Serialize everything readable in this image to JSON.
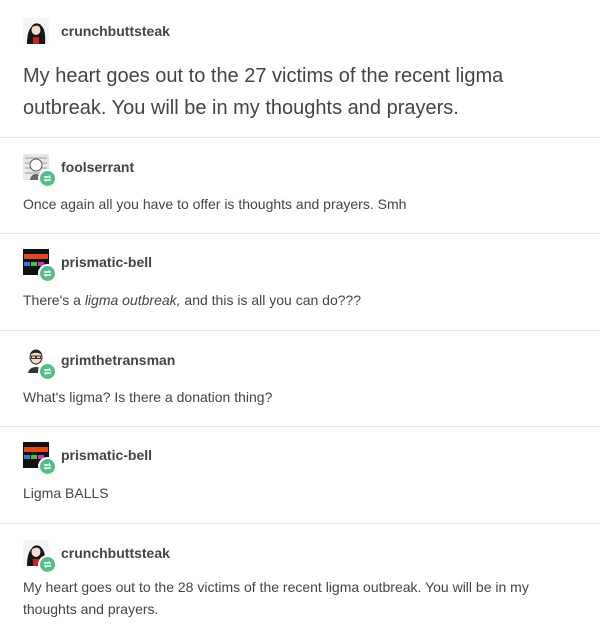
{
  "posts": [
    {
      "username": "crunchbuttsteak",
      "text": "My heart goes out to the 27 victims of the recent ligma outbreak. You will be in my thoughts and prayers.",
      "avatar_icon": "user-avatar-icon"
    },
    {
      "username": "foolserrant",
      "text": "Once again all you have to offer is thoughts and prayers. Smh",
      "avatar_icon": "user-avatar-icon"
    },
    {
      "username": "prismatic-bell",
      "text_before": "There's a ",
      "text_italic": "ligma outbreak,",
      "text_after": " and this is all you can do???",
      "avatar_icon": "queer-avatar-icon"
    },
    {
      "username": "grimthetransman",
      "text": "What's ligma? Is there a donation thing?",
      "avatar_icon": "user-avatar-icon"
    },
    {
      "username": "prismatic-bell",
      "text": "Ligma BALLS",
      "avatar_icon": "queer-avatar-icon"
    },
    {
      "username": "crunchbuttsteak",
      "text": "My heart goes out to the 28 victims of the recent ligma outbreak. You will be in my thoughts and prayers.",
      "avatar_icon": "user-avatar-icon"
    }
  ],
  "colors": {
    "reblog_badge": "#56bc8a",
    "text": "#444444",
    "divider": "#e4e4e4"
  }
}
